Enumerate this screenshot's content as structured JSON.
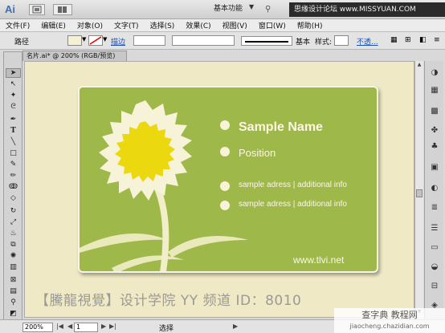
{
  "titlebar": {
    "app_logo": "Ai",
    "workspace": "基本功能",
    "watermark": "思缘设计论坛 www.MISSYUAN.COM"
  },
  "menu": [
    "文件(F)",
    "编辑(E)",
    "对象(O)",
    "文字(T)",
    "选择(S)",
    "效果(C)",
    "视图(V)",
    "窗口(W)",
    "帮助(H)"
  ],
  "controlbar": {
    "object_label": "路径",
    "stroke_link": "描边",
    "stroke_style": "基本",
    "style_label": "样式:",
    "opacity_link": "不透..."
  },
  "document": {
    "tab_title": "名片.ai* @ 200% (RGB/预览)",
    "close_glyph": "×"
  },
  "card": {
    "name": "Sample Name",
    "position": "Position",
    "address_1": "sample adress | additional info",
    "address_2": "sample adress | additional info",
    "url": "www.tlvi.net",
    "colors": {
      "background": "#9fb84a",
      "flower_petal": "#f7f3d8",
      "flower_center": "#ecd80f",
      "text": "#fbf7e2"
    }
  },
  "bottom_watermark": "【騰龍視覺】设计学院 YY 频道 ID：8010",
  "statusbar": {
    "zoom": "200%",
    "page": "1",
    "tool": "选择"
  },
  "site_watermark": {
    "line1": "查字典 教程网",
    "line2": "jiaocheng.chazidian.com"
  },
  "icons": {
    "tools": [
      "selection-arrow",
      "direct-selection-arrow",
      "magic-wand",
      "lasso",
      "pen",
      "type",
      "line",
      "rectangle",
      "paintbrush",
      "pencil",
      "blob-brush",
      "eraser",
      "rotate",
      "scale",
      "warp",
      "free-transform",
      "symbol-sprayer",
      "column-graph",
      "mesh",
      "gradient",
      "eyedropper",
      "blend",
      "live-paint",
      "artboard",
      "slice",
      "hand",
      "zoom"
    ],
    "right_panel": [
      "color",
      "color-guide",
      "swatches",
      "brushes",
      "symbols",
      "graphic-styles",
      "appearance",
      "layers",
      "stroke",
      "gradient",
      "transparency",
      "align",
      "pathfinder",
      "transform"
    ]
  }
}
